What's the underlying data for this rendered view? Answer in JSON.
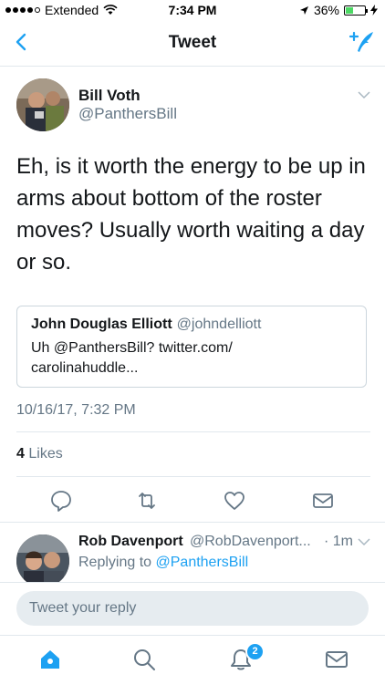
{
  "status_bar": {
    "carrier": "Extended",
    "time": "7:34 PM",
    "battery": "36%",
    "battery_level": 0.36
  },
  "nav": {
    "title": "Tweet"
  },
  "tweet": {
    "author_name": "Bill Voth",
    "author_handle": "@PanthersBill",
    "text": "Eh, is it worth the energy to be up in arms about bottom of the roster moves? Usually worth waiting a day or so.",
    "quote": {
      "name": "John Douglas Elliott",
      "handle": "@johndelliott",
      "text": "Uh @PanthersBill? twitter.com/\ncarolinahuddle..."
    },
    "timestamp": "10/16/17, 7:32 PM",
    "likes_count": "4",
    "likes_label": "Likes"
  },
  "reply": {
    "author_name": "Rob Davenport",
    "author_handle": "@RobDavenport...",
    "time": "· 1m",
    "replying_prefix": "Replying to",
    "replying_to": "@PanthersBill"
  },
  "reply_box": {
    "placeholder": "Tweet your reply"
  },
  "tab_bar": {
    "notifications_badge": "2"
  },
  "colors": {
    "accent": "#1da1f2",
    "secondary_text": "#657786",
    "divider": "#e1e8ed",
    "reply_field": "#e6ecf0"
  },
  "icons": {
    "back": "chevron-left-icon",
    "compose": "compose-tweet-icon",
    "caret": "chevron-down-icon",
    "reply": "reply-icon",
    "retweet": "retweet-icon",
    "like": "heart-icon",
    "dm": "envelope-icon",
    "home": "home-icon",
    "search": "search-icon",
    "notifications": "bell-icon",
    "messages": "envelope-icon"
  }
}
